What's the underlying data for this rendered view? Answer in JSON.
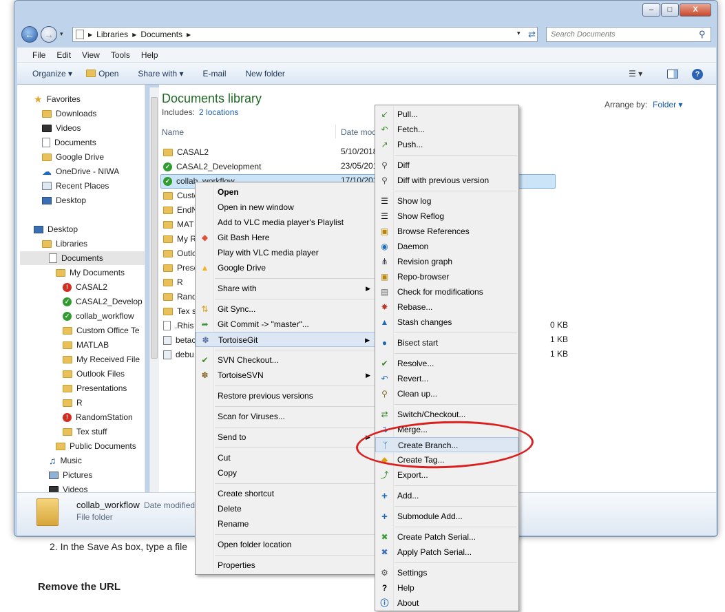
{
  "background": {
    "step_text": "2. In the Save As box, type a file",
    "heading": "Remove the URL"
  },
  "window": {
    "controls": {
      "minimize": "–",
      "maximize": "□",
      "close": "X"
    }
  },
  "address": {
    "path": [
      "Libraries",
      "Documents"
    ],
    "search_placeholder": "Search Documents"
  },
  "menubar": [
    "File",
    "Edit",
    "View",
    "Tools",
    "Help"
  ],
  "toolbar": {
    "organize": "Organize ▾",
    "open": "Open",
    "share": "Share with ▾",
    "email": "E-mail",
    "newfolder": "New folder"
  },
  "tree": {
    "favorites": "Favorites",
    "downloads": "Downloads",
    "videos": "Videos",
    "documents": "Documents",
    "gdrive": "Google Drive",
    "onedrive": "OneDrive - NIWA",
    "recent": "Recent Places",
    "desktop": "Desktop",
    "desktop2": "Desktop",
    "libraries": "Libraries",
    "documents2": "Documents",
    "mydocs": "My Documents",
    "casal2": "CASAL2",
    "casal2dev": "CASAL2_Develop",
    "collab": "collab_workflow",
    "custom": "Custom Office Te",
    "matlab": "MATLAB",
    "received": "My Received File",
    "outlook": "Outlook Files",
    "presentations": "Presentations",
    "r": "R",
    "random": "RandomStation",
    "tex": "Tex stuff",
    "public": "Public Documents",
    "music": "Music",
    "pictures": "Pictures",
    "videos2": "Videos"
  },
  "library": {
    "title": "Documents library",
    "includes": "Includes:",
    "locations": "2 locations",
    "arrange_label": "Arrange by:",
    "arrange_value": "Folder ▾"
  },
  "columns": {
    "name": "Name",
    "date": "Date mod"
  },
  "files": [
    {
      "name": "CASAL2",
      "date": "5/10/2018"
    },
    {
      "name": "CASAL2_Development",
      "date": "23/05/201"
    },
    {
      "name": "collab_workflow",
      "date": "17/10/201"
    },
    {
      "name": "Custo"
    },
    {
      "name": "EndN"
    },
    {
      "name": "MAT"
    },
    {
      "name": "My R"
    },
    {
      "name": "Outlo"
    },
    {
      "name": "Prese"
    },
    {
      "name": "R"
    },
    {
      "name": "Rand"
    },
    {
      "name": "Tex s"
    },
    {
      "name": ".Rhis",
      "size": "0 KB"
    },
    {
      "name": "betac",
      "size": "1 KB"
    },
    {
      "name": "debu",
      "size": "1 KB"
    }
  ],
  "details": {
    "name": "collab_workflow",
    "date_label": "Date modified",
    "type": "File folder"
  },
  "context_menu": {
    "open": "Open",
    "open_new": "Open in new window",
    "vlc_add": "Add to VLC media player's Playlist",
    "git_bash": "Git Bash Here",
    "vlc_play": "Play with VLC media player",
    "gdrive": "Google Drive",
    "share": "Share with",
    "git_sync": "Git Sync...",
    "git_commit": "Git Commit -> \"master\"...",
    "tortoisegit": "TortoiseGit",
    "svn_checkout": "SVN Checkout...",
    "tortoisesvn": "TortoiseSVN",
    "restore": "Restore previous versions",
    "scan": "Scan for Viruses...",
    "sendto": "Send to",
    "cut": "Cut",
    "copy": "Copy",
    "shortcut": "Create shortcut",
    "delete": "Delete",
    "rename": "Rename",
    "location": "Open folder location",
    "properties": "Properties"
  },
  "submenu": {
    "pull": "Pull...",
    "fetch": "Fetch...",
    "push": "Push...",
    "diff": "Diff",
    "diff_prev": "Diff with previous version",
    "showlog": "Show log",
    "reflog": "Show Reflog",
    "browse_refs": "Browse References",
    "daemon": "Daemon",
    "revgraph": "Revision graph",
    "repo": "Repo-browser",
    "check": "Check for modifications",
    "rebase": "Rebase...",
    "stash": "Stash changes",
    "bisect": "Bisect start",
    "resolve": "Resolve...",
    "revert": "Revert...",
    "cleanup": "Clean up...",
    "switch": "Switch/Checkout...",
    "merge": "Merge...",
    "branch": "Create Branch...",
    "tag": "Create Tag...",
    "export": "Export...",
    "add": "Add...",
    "submodule": "Submodule Add...",
    "patch": "Create Patch Serial...",
    "apply": "Apply Patch Serial...",
    "settings": "Settings",
    "help": "Help",
    "about": "About"
  },
  "highlight_color": "#d9201f"
}
